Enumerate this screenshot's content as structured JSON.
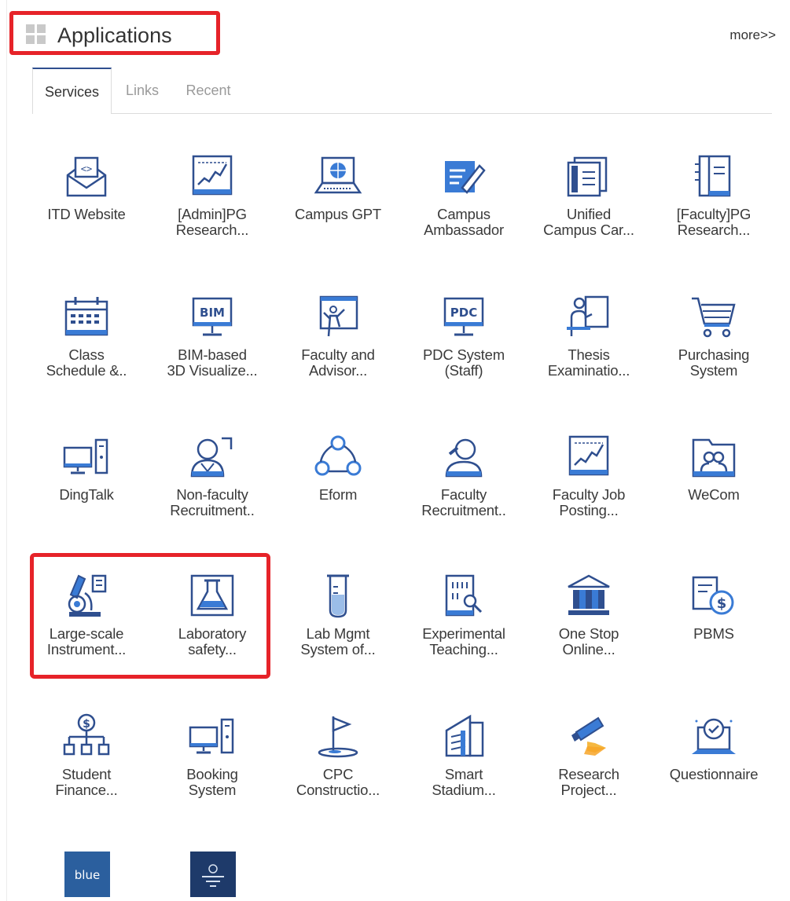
{
  "header": {
    "title": "Applications",
    "more": "more>>"
  },
  "tabs": [
    "Services",
    "Links",
    "Recent"
  ],
  "apps": [
    [
      "ITD Website",
      ""
    ],
    [
      "[Admin]PG",
      "Research..."
    ],
    [
      "Campus GPT",
      ""
    ],
    [
      "Campus",
      "Ambassador"
    ],
    [
      "Unified",
      "Campus Car..."
    ],
    [
      "[Faculty]PG",
      "Research..."
    ],
    [
      "Class",
      "Schedule &.."
    ],
    [
      "BIM-based",
      "3D Visualize..."
    ],
    [
      "Faculty and",
      "Advisor..."
    ],
    [
      "PDC System",
      "(Staff)"
    ],
    [
      "Thesis",
      "Examinatio..."
    ],
    [
      "Purchasing",
      "System"
    ],
    [
      "DingTalk",
      ""
    ],
    [
      "Non-faculty",
      "Recruitment.."
    ],
    [
      "Eform",
      ""
    ],
    [
      "Faculty",
      "Recruitment.."
    ],
    [
      "Faculty Job",
      "Posting..."
    ],
    [
      "WeCom",
      ""
    ],
    [
      "Large-scale",
      "Instrument..."
    ],
    [
      "Laboratory",
      "safety..."
    ],
    [
      "Lab Mgmt",
      "System of..."
    ],
    [
      "Experimental",
      "Teaching..."
    ],
    [
      "One Stop",
      "Online..."
    ],
    [
      "PBMS",
      ""
    ],
    [
      "Student",
      "Finance..."
    ],
    [
      "Booking",
      "System"
    ],
    [
      "CPC",
      "Constructio..."
    ],
    [
      "Smart",
      "Stadium..."
    ],
    [
      "Research",
      "Project..."
    ],
    [
      "Questionnaire",
      ""
    ]
  ],
  "tiles": {
    "blue": "blue"
  },
  "icons": [
    "code-mail-icon",
    "chart-board-icon",
    "laptop-globe-icon",
    "pen-note-icon",
    "id-card-icon",
    "document-icon",
    "calendar-icon",
    "bim-monitor-icon",
    "teacher-board-icon",
    "pdc-monitor-icon",
    "presenter-icon",
    "cart-icon",
    "computer-icon",
    "person-add-icon",
    "share-network-icon",
    "person-search-icon",
    "chart-board-icon",
    "wecom-folder-icon",
    "microscope-icon",
    "flask-icon",
    "test-tube-icon",
    "building-search-icon",
    "bank-icon",
    "dollar-list-icon",
    "finance-tree-icon",
    "computer-icon",
    "flag-icon",
    "stadium-icon",
    "telescope-icon",
    "survey-laptop-icon"
  ],
  "colors": {
    "accent": "#2f4f8f",
    "icon_blue": "#3a7bd5",
    "highlight": "#e62329"
  }
}
